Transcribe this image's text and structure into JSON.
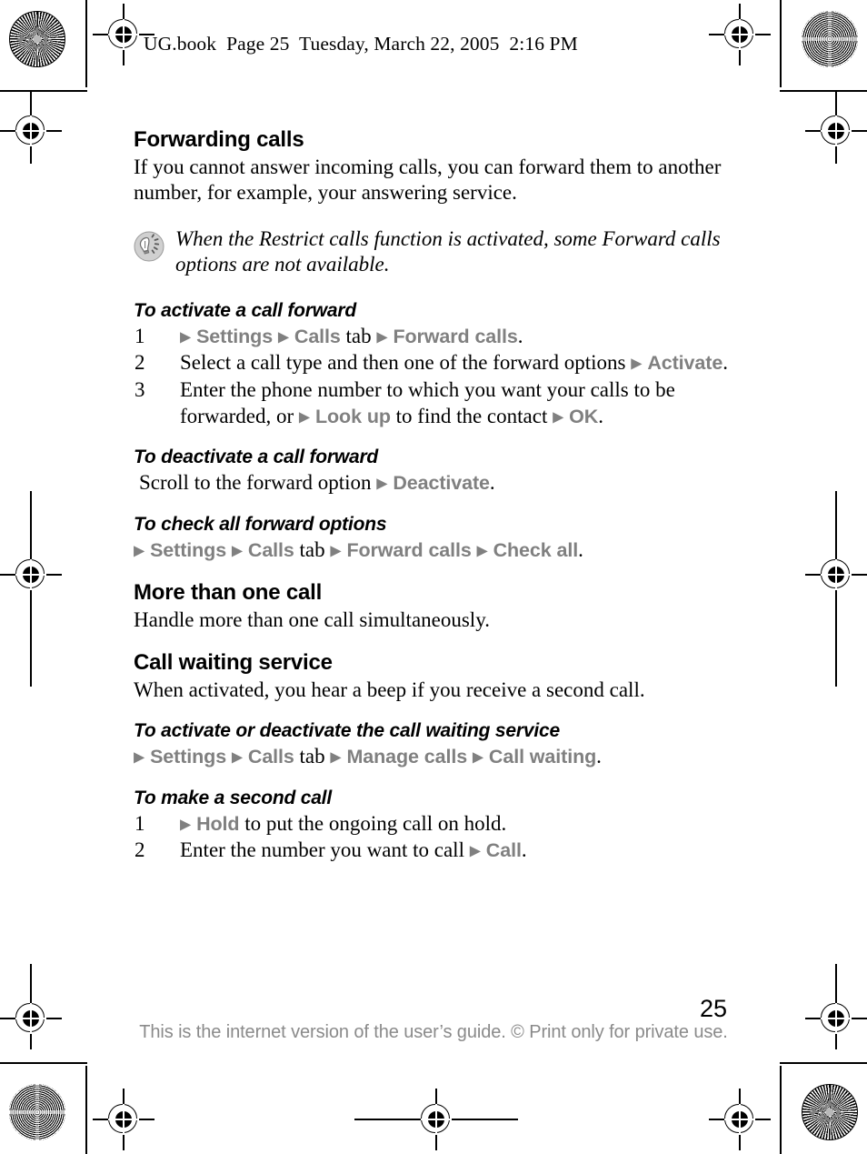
{
  "header": {
    "text": "UG.book  Page 25  Tuesday, March 22, 2005  2:16 PM"
  },
  "colors": {
    "ui_term_grey": "#808080",
    "footer_grey": "#8a8a8a",
    "body_black": "#000000"
  },
  "content": {
    "section_title": "Forwarding calls",
    "intro_paragraph": "If you cannot answer incoming calls, you can forward them to another number, for example, your answering service.",
    "note": {
      "icon": "lightbulb-tip-icon",
      "text": "When the Restrict calls function is activated, some Forward calls options are not available."
    },
    "activate_forward": {
      "heading": "To activate a call forward",
      "steps": [
        {
          "number": "1",
          "parts": [
            {
              "type": "arrow",
              "text": "▶"
            },
            {
              "type": "ui",
              "text": "Settings"
            },
            {
              "type": "arrow",
              "text": "▶"
            },
            {
              "type": "ui",
              "text": "Calls"
            },
            {
              "type": "plain",
              "text": " tab "
            },
            {
              "type": "arrow",
              "text": "▶"
            },
            {
              "type": "ui",
              "text": "Forward calls"
            },
            {
              "type": "plain",
              "text": "."
            }
          ]
        },
        {
          "number": "2",
          "parts": [
            {
              "type": "plain",
              "text": "Select a call type and then one of the forward options "
            },
            {
              "type": "arrow",
              "text": "▶"
            },
            {
              "type": "ui",
              "text": "Activate"
            },
            {
              "type": "plain",
              "text": "."
            }
          ]
        },
        {
          "number": "3",
          "parts": [
            {
              "type": "plain",
              "text": "Enter the phone number to which you want your calls to be forwarded, or "
            },
            {
              "type": "arrow",
              "text": "▶"
            },
            {
              "type": "ui",
              "text": "Look up"
            },
            {
              "type": "plain",
              "text": " to find the contact "
            },
            {
              "type": "arrow",
              "text": "▶"
            },
            {
              "type": "ui",
              "text": "OK"
            },
            {
              "type": "plain",
              "text": "."
            }
          ]
        }
      ]
    },
    "deactivate_forward": {
      "heading": "To deactivate a call forward",
      "line": [
        {
          "type": "plain",
          "text": "Scroll to the forward option "
        },
        {
          "type": "arrow",
          "text": "▶"
        },
        {
          "type": "ui",
          "text": "Deactivate"
        },
        {
          "type": "plain",
          "text": "."
        }
      ]
    },
    "check_all_forward": {
      "heading": "To check all forward options",
      "line": [
        {
          "type": "arrow",
          "text": "▶"
        },
        {
          "type": "ui",
          "text": "Settings"
        },
        {
          "type": "arrow",
          "text": "▶"
        },
        {
          "type": "ui",
          "text": "Calls"
        },
        {
          "type": "plain",
          "text": " tab "
        },
        {
          "type": "arrow",
          "text": "▶"
        },
        {
          "type": "ui",
          "text": "Forward calls"
        },
        {
          "type": "arrow",
          "text": "▶"
        },
        {
          "type": "ui",
          "text": "Check all"
        },
        {
          "type": "plain",
          "text": "."
        }
      ]
    },
    "more_than_one_call": {
      "title": "More than one call",
      "paragraph": "Handle more than one call simultaneously."
    },
    "call_waiting_service": {
      "title": "Call waiting service",
      "paragraph": "When activated, you hear a beep if you receive a second call."
    },
    "activate_deactivate_waiting": {
      "heading": "To activate or deactivate the call waiting service",
      "line": [
        {
          "type": "arrow",
          "text": "▶"
        },
        {
          "type": "ui",
          "text": "Settings"
        },
        {
          "type": "arrow",
          "text": "▶"
        },
        {
          "type": "ui",
          "text": "Calls"
        },
        {
          "type": "plain",
          "text": " tab "
        },
        {
          "type": "arrow",
          "text": "▶"
        },
        {
          "type": "ui",
          "text": "Manage calls"
        },
        {
          "type": "arrow",
          "text": "▶"
        },
        {
          "type": "ui",
          "text": "Call waiting"
        },
        {
          "type": "plain",
          "text": "."
        }
      ]
    },
    "second_call": {
      "heading": "To make a second call",
      "steps": [
        {
          "number": "1",
          "parts": [
            {
              "type": "arrow",
              "text": "▶"
            },
            {
              "type": "ui",
              "text": "Hold"
            },
            {
              "type": "plain",
              "text": " to put the ongoing call on hold."
            }
          ]
        },
        {
          "number": "2",
          "parts": [
            {
              "type": "plain",
              "text": "Enter the number you want to call "
            },
            {
              "type": "arrow",
              "text": "▶"
            },
            {
              "type": "ui",
              "text": "Call"
            },
            {
              "type": "plain",
              "text": "."
            }
          ]
        }
      ]
    }
  },
  "footer": {
    "page_number": "25",
    "note": "This is the internet version of the user’s guide. © Print only for private use."
  }
}
